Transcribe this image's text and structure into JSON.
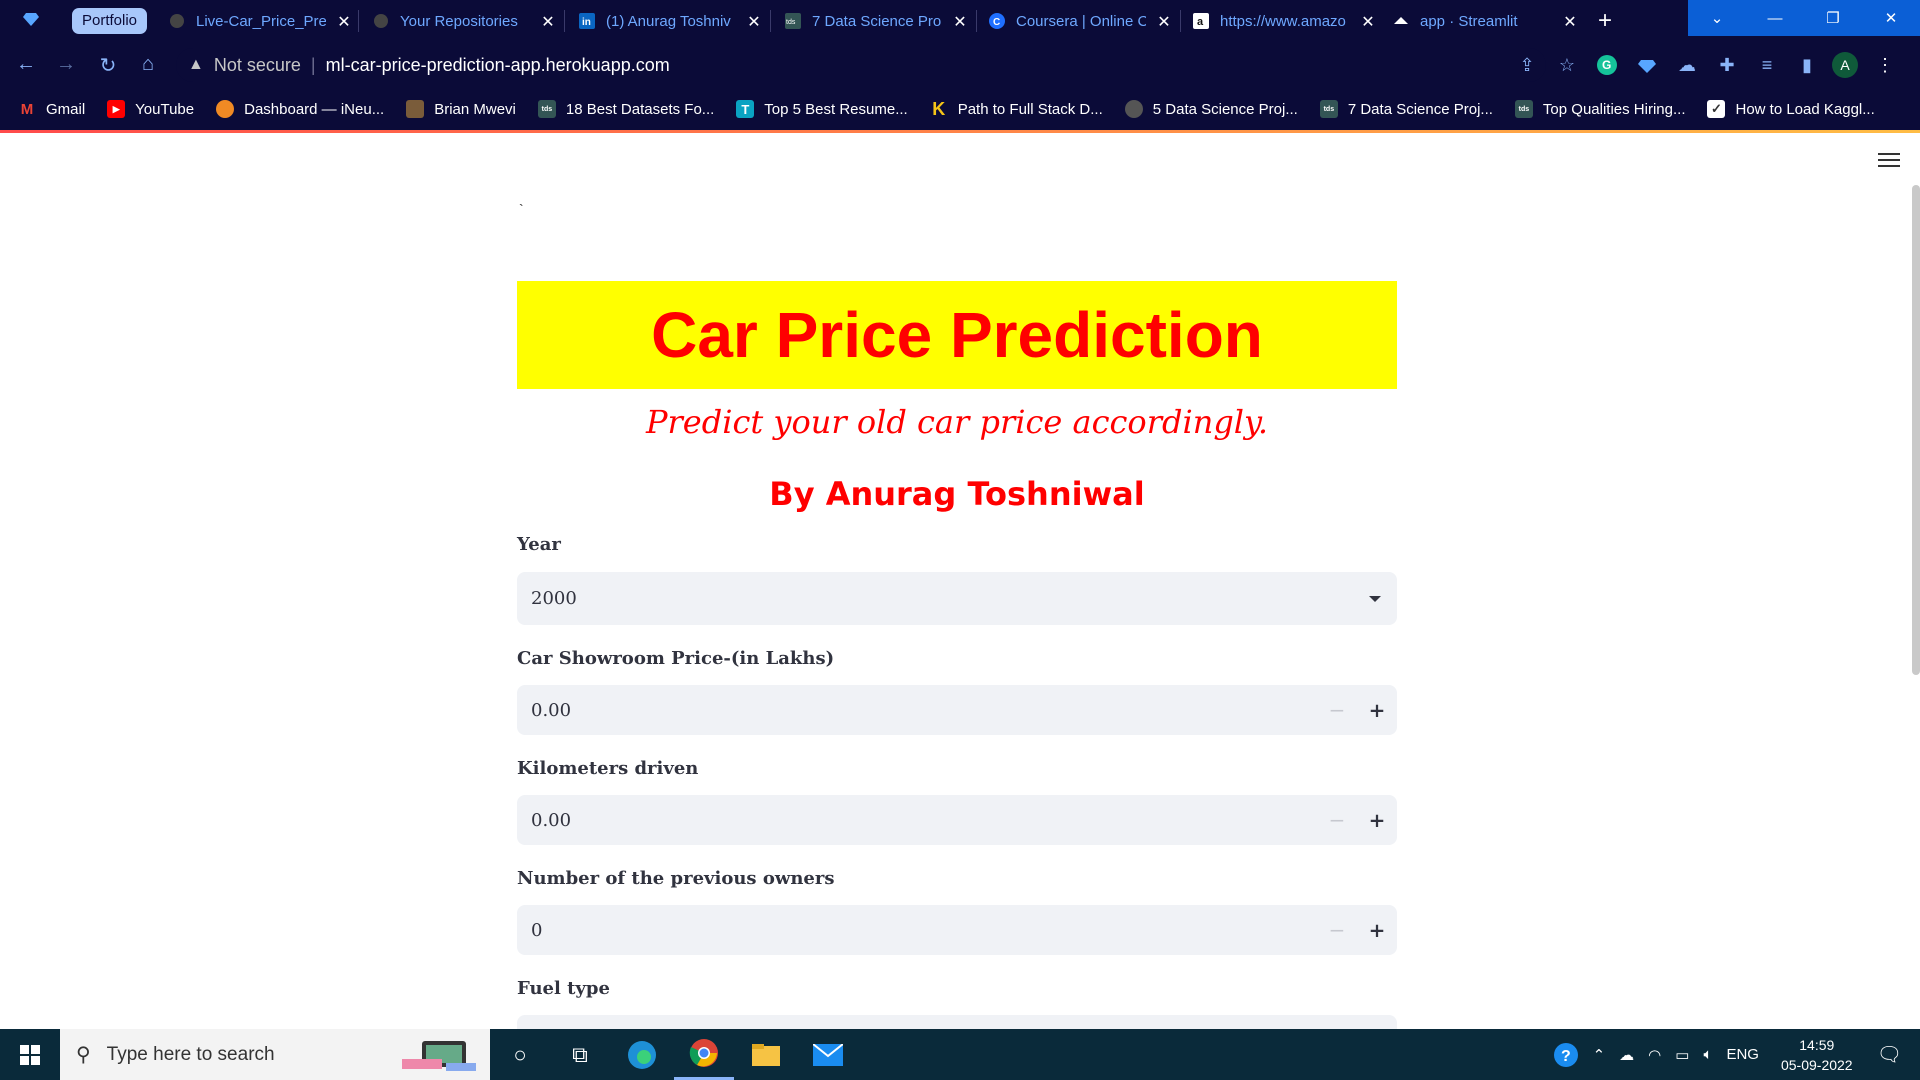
{
  "browser": {
    "tab_group_label": "Portfolio",
    "tabs": [
      {
        "title": "Live-Car_Price_Prec",
        "icon": "github-icon"
      },
      {
        "title": "Your Repositories",
        "icon": "github-icon"
      },
      {
        "title": "(1) Anurag Toshniv",
        "icon": "linkedin-icon"
      },
      {
        "title": "7 Data Science Pro",
        "icon": "tds-icon"
      },
      {
        "title": "Coursera | Online C",
        "icon": "coursera-icon"
      },
      {
        "title": "https://www.amazo",
        "icon": "amazon-icon"
      },
      {
        "title": "app · Streamlit",
        "icon": "streamlit-icon"
      }
    ],
    "address": {
      "security_label": "Not secure",
      "url": "ml-car-price-prediction-app.herokuapp.com"
    },
    "profile_initial": "A",
    "bookmarks": [
      {
        "label": "Gmail",
        "icon": "gmail-icon"
      },
      {
        "label": "YouTube",
        "icon": "youtube-icon"
      },
      {
        "label": "Dashboard — iNeu...",
        "icon": "ineuron-icon"
      },
      {
        "label": "Brian Mwevi",
        "icon": "person-icon"
      },
      {
        "label": "18 Best Datasets Fo...",
        "icon": "tds-icon"
      },
      {
        "label": "Top 5 Best Resume...",
        "icon": "t-icon"
      },
      {
        "label": "Path to Full Stack D...",
        "icon": "k-icon"
      },
      {
        "label": "5 Data Science Proj...",
        "icon": "globe-icon"
      },
      {
        "label": "7 Data Science Proj...",
        "icon": "tds-icon"
      },
      {
        "label": "Top Qualities Hiring...",
        "icon": "tds-icon"
      },
      {
        "label": "How to Load Kaggl...",
        "icon": "check-icon"
      }
    ],
    "colors": {
      "chrome_bg": "#0b0b38",
      "tab_text": "#6ea8ff",
      "accent": "#0b5fd6"
    }
  },
  "app": {
    "stray_mark": "`",
    "title": "Car Price Prediction",
    "subtitle": "Predict your old car price accordingly.",
    "byline": "By Anurag Toshniwal",
    "colors": {
      "banner_bg": "#ffff00",
      "title_color": "#ff0000",
      "field_bg": "#f0f2f6"
    },
    "fields": [
      {
        "label": "Year",
        "type": "select",
        "value": "2000"
      },
      {
        "label": "Car Showroom Price-(in Lakhs)",
        "type": "number",
        "value": "0.00"
      },
      {
        "label": "Kilometers driven",
        "type": "number",
        "value": "0.00"
      },
      {
        "label": "Number of the previous owners",
        "type": "number",
        "value": "0"
      },
      {
        "label": "Fuel type",
        "type": "select",
        "value": ""
      }
    ]
  },
  "taskbar": {
    "search_placeholder": "Type here to search",
    "language": "ENG",
    "time": "14:59",
    "date": "05-09-2022"
  }
}
